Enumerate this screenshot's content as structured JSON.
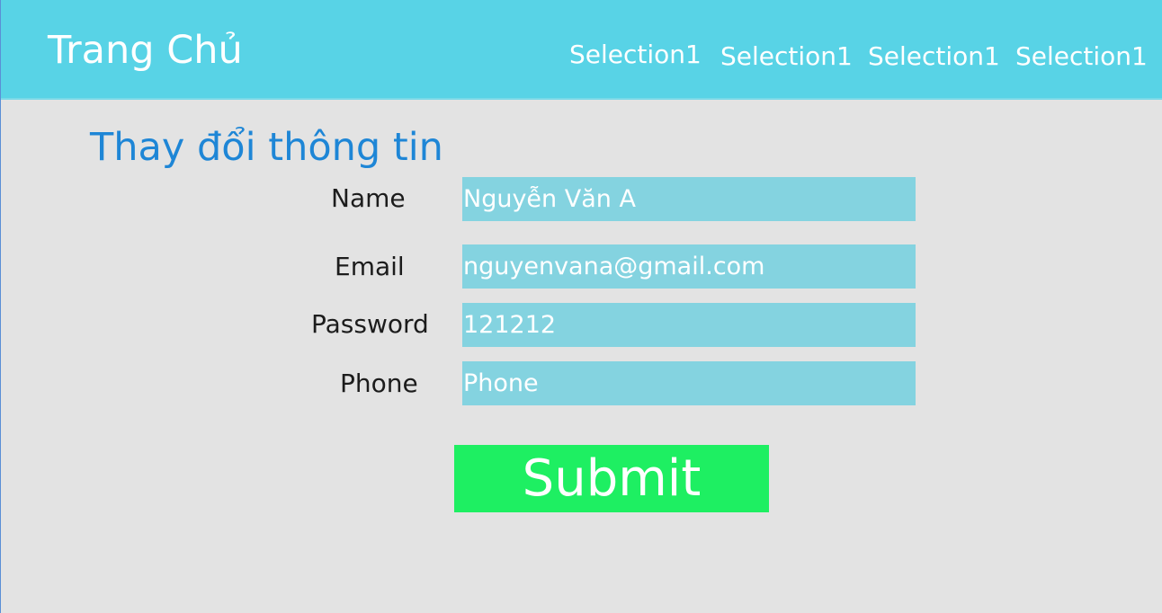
{
  "header": {
    "brand": "Trang Chủ",
    "nav": [
      {
        "label": "Selection1"
      },
      {
        "label": "Selection1"
      },
      {
        "label": "Selection1"
      },
      {
        "label": "Selection1"
      }
    ]
  },
  "main": {
    "title": "Thay đổi thông tin",
    "form": {
      "name": {
        "label": "Name",
        "value": "Nguyễn Văn A"
      },
      "email": {
        "label": "Email",
        "value": "nguyenvana@gmail.com"
      },
      "password": {
        "label": "Password",
        "value": "121212"
      },
      "phone": {
        "label": "Phone",
        "placeholder": "Phone",
        "value": ""
      },
      "submit_label": "Submit"
    }
  },
  "colors": {
    "header_bg": "#58d3e6",
    "page_bg": "#e3e3e3",
    "title": "#1e86d6",
    "input_bg": "#84d3e0",
    "submit_bg": "#1eef62"
  }
}
